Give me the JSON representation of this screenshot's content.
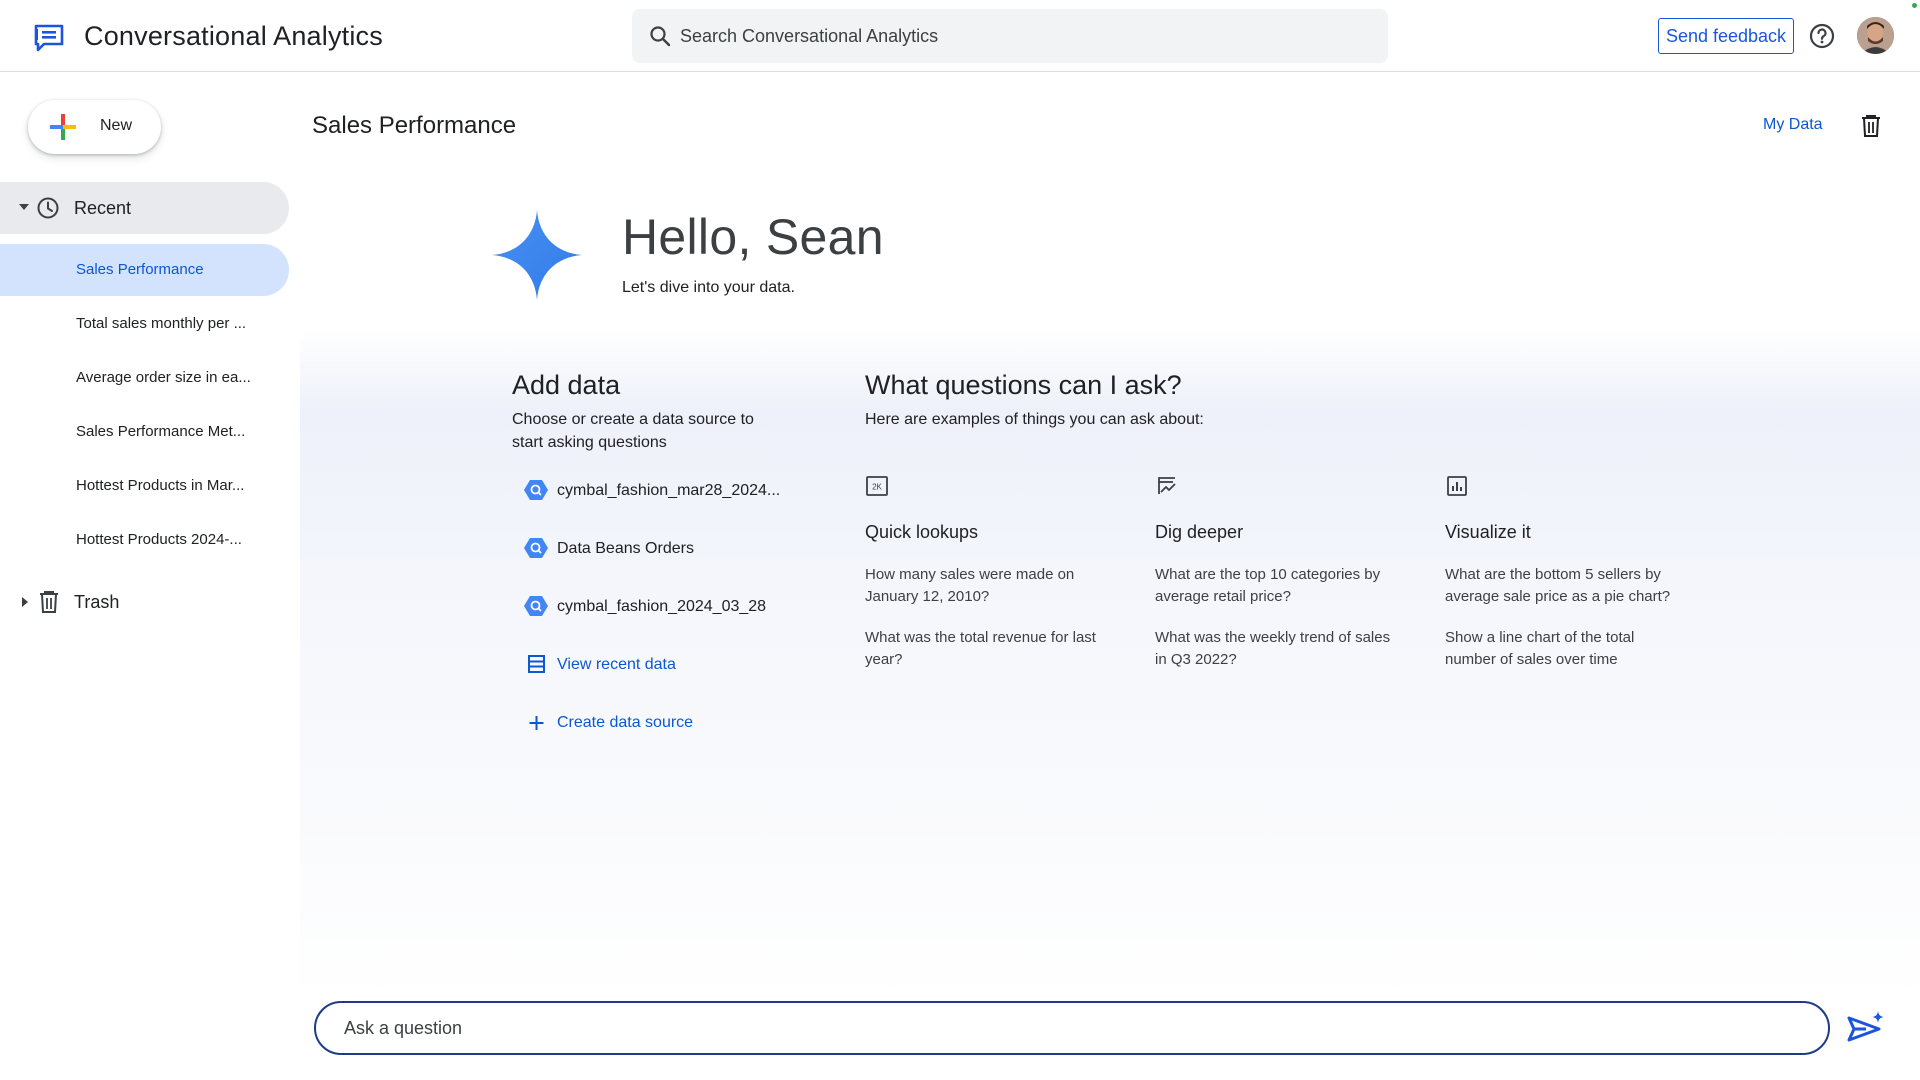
{
  "header": {
    "app_title": "Conversational Analytics",
    "search_placeholder": "Search Conversational Analytics",
    "feedback_label": "Send feedback",
    "logo_icon": "chat-analytics-icon",
    "help_icon": "help-circle-icon",
    "accent_color": "#1a56db"
  },
  "sidebar": {
    "new_label": "New",
    "recent_label": "Recent",
    "items": [
      {
        "label": "Sales Performance",
        "active": true
      },
      {
        "label": "Total sales monthly per ..."
      },
      {
        "label": "Average order size in ea..."
      },
      {
        "label": "Sales Performance Met..."
      },
      {
        "label": "Hottest Products in Mar..."
      },
      {
        "label": "Hottest Products 2024-..."
      }
    ],
    "trash_label": "Trash"
  },
  "main": {
    "page_title": "Sales Performance",
    "my_data_label": "My Data",
    "greeting": "Hello, Sean",
    "greeting_sub": "Let's dive into your data.",
    "add_data": {
      "title": "Add data",
      "subtitle_line1": "Choose or create a data source to",
      "subtitle_line2": "start asking questions",
      "sources": [
        {
          "label": "cymbal_fashion_mar28_2024...",
          "icon": "bigquery-icon"
        },
        {
          "label": "Data Beans Orders",
          "icon": "bigquery-icon"
        },
        {
          "label": "cymbal_fashion_2024_03_28",
          "icon": "bigquery-icon"
        }
      ],
      "view_recent_label": "View recent data",
      "create_label": "Create data source"
    },
    "questions": {
      "title": "What questions can I ask?",
      "subtitle": "Here are examples of things you can ask about:",
      "columns": [
        {
          "icon": "number-lookup-icon",
          "title": "Quick lookups",
          "q1_line1": "How many sales were made on",
          "q1_line2": "January 12, 2010?",
          "q2_line1": "What was the total revenue for last",
          "q2_line2": "year?"
        },
        {
          "icon": "trend-edit-icon",
          "title": "Dig deeper",
          "q1_line1": "What are the top 10 categories by",
          "q1_line2": "average retail price?",
          "q2_line1": "What was the weekly trend of sales",
          "q2_line2": "in Q3 2022?"
        },
        {
          "icon": "bar-chart-icon",
          "title": "Visualize it",
          "q1_line1": "What are the bottom 5 sellers by",
          "q1_line2": "average sale price as a pie chart?",
          "q2_line1": "Show a line chart of the total",
          "q2_line2": "number of sales over time"
        }
      ]
    }
  },
  "ask": {
    "placeholder": "Ask a question"
  }
}
